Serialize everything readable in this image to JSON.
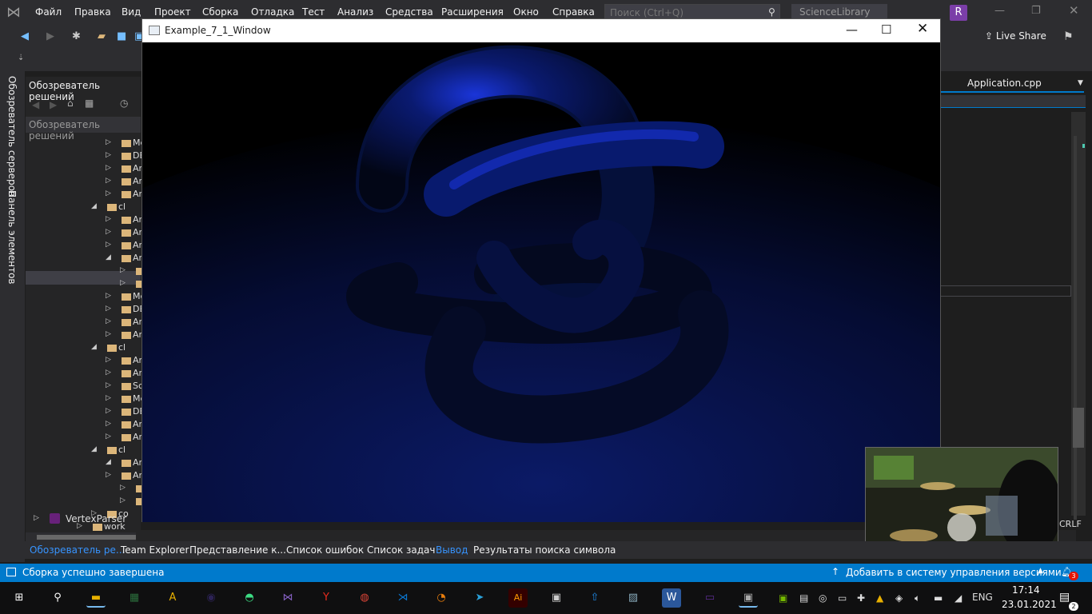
{
  "menubar": {
    "items": [
      "Файл",
      "Правка",
      "Вид",
      "Проект",
      "Сборка",
      "Отладка",
      "Тест",
      "Анализ",
      "Средства",
      "Расширения",
      "Окно",
      "Справка"
    ],
    "search_placeholder": "Поиск (Ctrl+Q)",
    "project_name": "ScienceLibrary",
    "avatar_letter": "R"
  },
  "toolbar": {
    "live_share": "Live Share"
  },
  "side_tabs": {
    "server_explorer": "Обозреватель серверов",
    "toolbox": "Панель элементов"
  },
  "solution_explorer": {
    "title": "Обозреватель решений",
    "search_placeholder": "Обозреватель решений",
    "rows": [
      {
        "label": "Me",
        "indent": 2,
        "expanded": false
      },
      {
        "label": "DE",
        "indent": 2,
        "expanded": false
      },
      {
        "label": "Ar",
        "indent": 2,
        "expanded": false
      },
      {
        "label": "Ar",
        "indent": 2,
        "expanded": false
      },
      {
        "label": "Ar",
        "indent": 2,
        "expanded": false
      },
      {
        "label": "cl",
        "indent": 1,
        "expanded": true
      },
      {
        "label": "Ar",
        "indent": 2,
        "expanded": false
      },
      {
        "label": "Ar",
        "indent": 2,
        "expanded": false
      },
      {
        "label": "Ar",
        "indent": 2,
        "expanded": false
      },
      {
        "label": "Ar",
        "indent": 2,
        "expanded": true
      },
      {
        "label": "Ar",
        "indent": 3,
        "expanded": false
      },
      {
        "label": "Sc",
        "indent": 3,
        "expanded": false
      },
      {
        "label": "Me",
        "indent": 2,
        "expanded": false
      },
      {
        "label": "DE",
        "indent": 2,
        "expanded": false
      },
      {
        "label": "Ar",
        "indent": 2,
        "expanded": false
      },
      {
        "label": "Ar",
        "indent": 2,
        "expanded": false
      },
      {
        "label": "cl",
        "indent": 1,
        "expanded": true
      },
      {
        "label": "Ar",
        "indent": 2,
        "expanded": false
      },
      {
        "label": "Ar",
        "indent": 2,
        "expanded": false
      },
      {
        "label": "Sc",
        "indent": 2,
        "expanded": false
      },
      {
        "label": "Me",
        "indent": 2,
        "expanded": false
      },
      {
        "label": "DE",
        "indent": 2,
        "expanded": false
      },
      {
        "label": "Ar",
        "indent": 2,
        "expanded": false
      },
      {
        "label": "Ar",
        "indent": 2,
        "expanded": false
      },
      {
        "label": "cl",
        "indent": 1,
        "expanded": true
      },
      {
        "label": "Ar",
        "indent": 2,
        "expanded": true
      },
      {
        "label": "Ar",
        "indent": 2,
        "expanded": false
      },
      {
        "label": "Fr",
        "indent": 3,
        "expanded": false
      },
      {
        "label": "",
        "indent": 3,
        "expanded": false
      },
      {
        "label": "co",
        "indent": 1,
        "expanded": false
      },
      {
        "label": "work",
        "indent": 0,
        "expanded": false
      }
    ],
    "project": "VertexParser"
  },
  "editor": {
    "doc_tab": "Application.cpp",
    "line_ending": "CRLF"
  },
  "app_window": {
    "title": "Example_7_1_Window"
  },
  "bottom_tabs": [
    {
      "label": "Обозреватель ре...",
      "active": true
    },
    {
      "label": "Team Explorer",
      "active": false
    },
    {
      "label": "Представление к...",
      "active": false
    },
    {
      "label": "Список ошибок",
      "active": false
    },
    {
      "label": "Список задач",
      "active": false
    },
    {
      "label": "Вывод",
      "active": true
    },
    {
      "label": "Результаты поиска символа",
      "active": false
    }
  ],
  "statusbar": {
    "message": "Сборка успешно завершена",
    "vcs": "Добавить в систему управления версиями",
    "notifications": "3"
  },
  "taskbar": {
    "apps": [
      "start-icon",
      "search-icon",
      "file-explorer-icon",
      "calculator-icon",
      "autocad-icon",
      "eclipse-icon",
      "android-studio-icon",
      "visual-studio-icon",
      "yandex-browser-icon",
      "chrome-icon",
      "vscode-icon",
      "blender-icon",
      "telegram-icon",
      "illustrator-icon",
      "app-window-icon",
      "upload-app-icon",
      "photos-icon",
      "word-icon",
      "terminal-icon",
      "active-app-icon"
    ],
    "lang": "ENG",
    "time": "17:14",
    "date": "23.01.2021",
    "notif_count": "2"
  },
  "colors": {
    "accent": "#007acc",
    "menubar": "#2d2d30",
    "panel": "#252526",
    "render_blue": "#1a35d8"
  }
}
